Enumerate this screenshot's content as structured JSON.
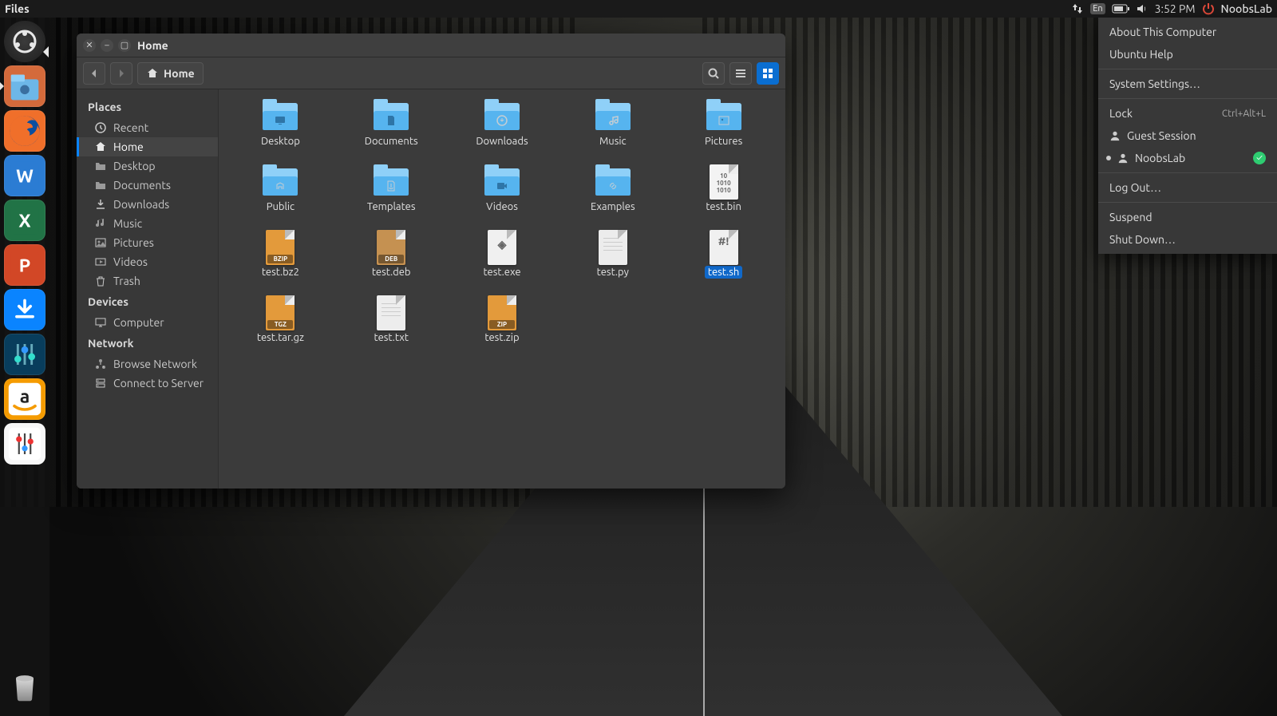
{
  "menubar": {
    "app_name": "Files",
    "lang": "En",
    "clock": "3:52 PM",
    "username": "NoobsLab"
  },
  "launcher": {
    "items": [
      {
        "name": "dash",
        "color": "#2b2b2b"
      },
      {
        "name": "files",
        "color": "#d46a3b",
        "active": true
      },
      {
        "name": "firefox",
        "color": "#f06f2a"
      },
      {
        "name": "word",
        "color": "#2b7cd3"
      },
      {
        "name": "excel",
        "color": "#217346"
      },
      {
        "name": "powerpoint",
        "color": "#d24726"
      },
      {
        "name": "download",
        "color": "#0a84ff"
      },
      {
        "name": "mixer",
        "color": "#083d5c"
      },
      {
        "name": "amazon",
        "color": "#f59b00"
      },
      {
        "name": "settings-tool",
        "color": "#f7f7f7"
      }
    ],
    "trash": "Trash"
  },
  "fm": {
    "title": "Home",
    "path_label": "Home",
    "sidebar": {
      "places_hdr": "Places",
      "devices_hdr": "Devices",
      "network_hdr": "Network",
      "places": [
        {
          "icon": "clock",
          "label": "Recent"
        },
        {
          "icon": "home",
          "label": "Home",
          "selected": true
        },
        {
          "icon": "folder",
          "label": "Desktop"
        },
        {
          "icon": "folder",
          "label": "Documents"
        },
        {
          "icon": "download",
          "label": "Downloads"
        },
        {
          "icon": "music",
          "label": "Music"
        },
        {
          "icon": "picture",
          "label": "Pictures"
        },
        {
          "icon": "video",
          "label": "Videos"
        },
        {
          "icon": "trash",
          "label": "Trash"
        }
      ],
      "devices": [
        {
          "icon": "computer",
          "label": "Computer"
        }
      ],
      "network": [
        {
          "icon": "network",
          "label": "Browse Network"
        },
        {
          "icon": "server",
          "label": "Connect to Server"
        }
      ]
    },
    "items": [
      {
        "kind": "folder",
        "label": "Desktop",
        "glyph": "desktop"
      },
      {
        "kind": "folder",
        "label": "Documents",
        "glyph": "doc"
      },
      {
        "kind": "folder",
        "label": "Downloads",
        "glyph": "dl"
      },
      {
        "kind": "folder",
        "label": "Music",
        "glyph": "music"
      },
      {
        "kind": "folder",
        "label": "Pictures",
        "glyph": "pic"
      },
      {
        "kind": "folder",
        "label": "Public",
        "glyph": "public"
      },
      {
        "kind": "folder",
        "label": "Templates",
        "glyph": "tmpl"
      },
      {
        "kind": "folder",
        "label": "Videos",
        "glyph": "video"
      },
      {
        "kind": "folder",
        "label": "Examples",
        "glyph": "link"
      },
      {
        "kind": "file",
        "label": "test.bin",
        "ext": "bin"
      },
      {
        "kind": "file",
        "label": "test.bz2",
        "ext": "bz2",
        "badge": "BZIP"
      },
      {
        "kind": "file",
        "label": "test.deb",
        "ext": "deb",
        "badge": "DEB"
      },
      {
        "kind": "file",
        "label": "test.exe",
        "ext": "exe"
      },
      {
        "kind": "file",
        "label": "test.py",
        "ext": "py"
      },
      {
        "kind": "file",
        "label": "test.sh",
        "ext": "sh",
        "mark": "#!",
        "selected": true
      },
      {
        "kind": "file",
        "label": "test.tar.gz",
        "ext": "tgz",
        "badge": "TGZ"
      },
      {
        "kind": "file",
        "label": "test.txt",
        "ext": "txt"
      },
      {
        "kind": "file",
        "label": "test.zip",
        "ext": "zip",
        "badge": "ZIP"
      }
    ]
  },
  "sysmenu": {
    "about": "About This Computer",
    "help": "Ubuntu Help",
    "settings": "System Settings…",
    "lock": "Lock",
    "lock_accel": "Ctrl+Alt+L",
    "guest": "Guest Session",
    "user": "NoobsLab",
    "logout": "Log Out…",
    "suspend": "Suspend",
    "shutdown": "Shut Down…"
  }
}
